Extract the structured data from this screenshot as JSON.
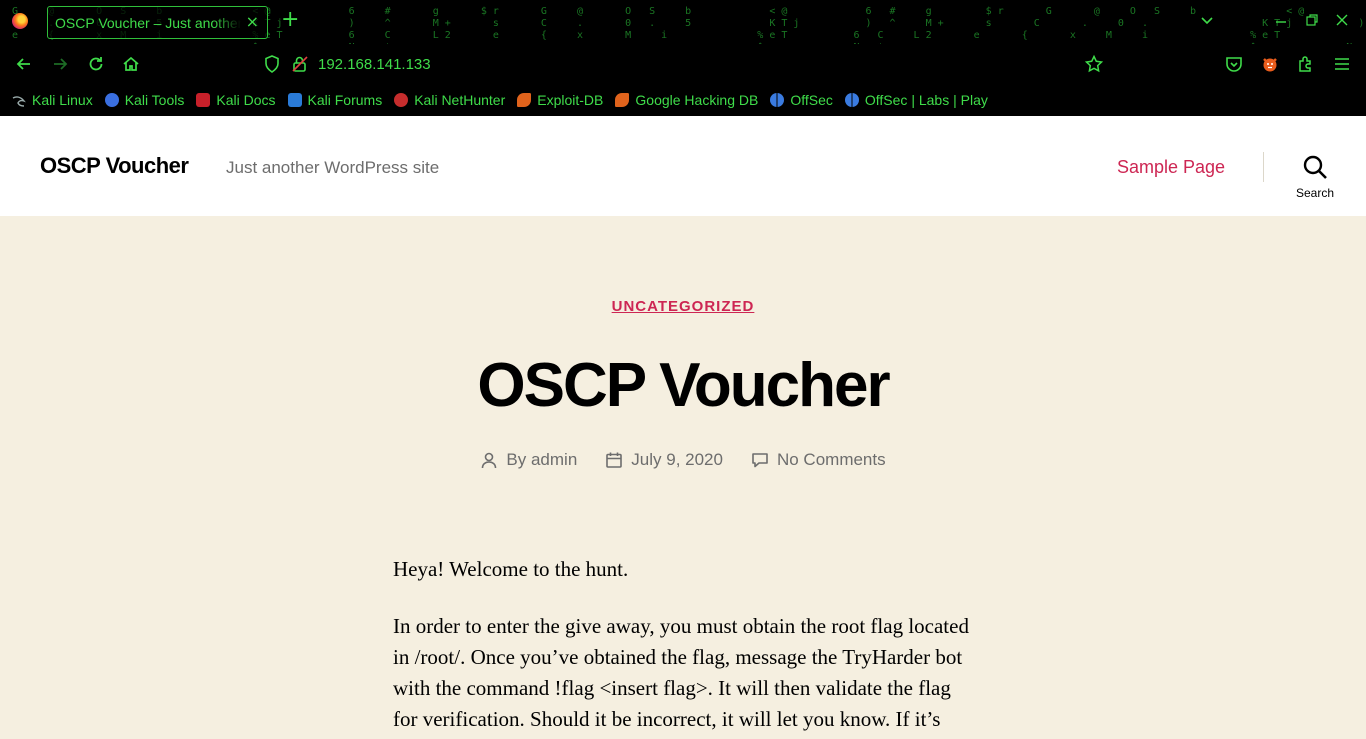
{
  "browser": {
    "tab_title": "OSCP Voucher – Just another WordPress site",
    "url": "192.168.141.133",
    "colors": {
      "chrome_bg": "#000000",
      "chrome_fg": "#3fdc4a"
    },
    "bookmarks": [
      {
        "label": "Kali Linux",
        "icon": "kali-dragon-icon"
      },
      {
        "label": "Kali Tools",
        "icon": "kali-tools-icon"
      },
      {
        "label": "Kali Docs",
        "icon": "kali-docs-icon"
      },
      {
        "label": "Kali Forums",
        "icon": "kali-forums-icon"
      },
      {
        "label": "Kali NetHunter",
        "icon": "nethunter-icon"
      },
      {
        "label": "Exploit-DB",
        "icon": "exploit-db-icon"
      },
      {
        "label": "Google Hacking DB",
        "icon": "ghdb-icon"
      },
      {
        "label": "OffSec",
        "icon": "offsec-icon"
      },
      {
        "label": "OffSec | Labs | Play",
        "icon": "offsec-icon"
      }
    ]
  },
  "site": {
    "title": "OSCP Voucher",
    "description": "Just another WordPress site",
    "menu_item": "Sample Page",
    "search_label": "Search",
    "colors": {
      "accent": "#cd2653",
      "background": "#f5efe0"
    }
  },
  "post": {
    "category": "UNCATEGORIZED",
    "title": "OSCP Voucher",
    "author_prefix": "By",
    "author": "admin",
    "date": "July 9, 2020",
    "comments": "No Comments",
    "paragraphs": [
      "Heya! Welcome to the hunt.",
      "In order to enter the give away, you must obtain the root flag located in /root/. Once you’ve obtained the flag, message the TryHarder bot with the command !flag <insert flag>. It will then validate the flag for verification. Should it be incorrect, it will let you know. If it’s"
    ]
  }
}
